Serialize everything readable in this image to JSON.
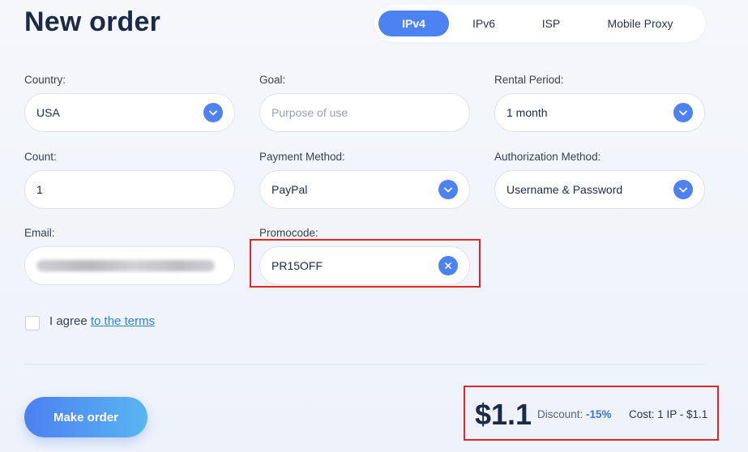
{
  "page": {
    "title": "New order"
  },
  "tabs": [
    {
      "label": "IPv4",
      "active": true
    },
    {
      "label": "IPv6",
      "active": false
    },
    {
      "label": "ISP",
      "active": false
    },
    {
      "label": "Mobile Proxy",
      "active": false
    }
  ],
  "form": {
    "country": {
      "label": "Country:",
      "value": "USA"
    },
    "goal": {
      "label": "Goal:",
      "value": "",
      "placeholder": "Purpose of use"
    },
    "rental_period": {
      "label": "Rental Period:",
      "value": "1 month"
    },
    "count": {
      "label": "Count:",
      "value": "1"
    },
    "payment_method": {
      "label": "Payment Method:",
      "value": "PayPal"
    },
    "authorization_method": {
      "label": "Authorization Method:",
      "value": "Username & Password"
    },
    "email": {
      "label": "Email:"
    },
    "promocode": {
      "label": "Promocode:",
      "value": "PR15OFF"
    }
  },
  "agree": {
    "text": "I agree",
    "link": "to the terms"
  },
  "actions": {
    "make_order": "Make order"
  },
  "summary": {
    "price": "$1.1",
    "discount_label": "Discount:",
    "discount_value": "-15%",
    "cost": "Cost: 1 IP - $1.1"
  },
  "colors": {
    "accent": "#4d82f3",
    "highlight": "#e3262b",
    "link": "#2f86c9"
  },
  "icons": {
    "dropdown": "chevron-down-icon",
    "clear": "close-icon"
  }
}
